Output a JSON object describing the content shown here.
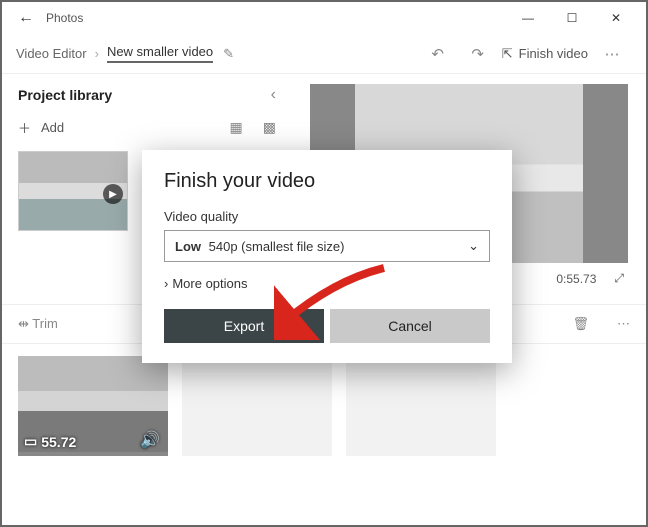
{
  "app": {
    "title": "Photos"
  },
  "breadcrumb": {
    "root": "Video Editor",
    "current": "New smaller video"
  },
  "toolbar": {
    "finish_label": "Finish video"
  },
  "library": {
    "title": "Project library",
    "add_label": "Add"
  },
  "preview": {
    "time": "0:55.73"
  },
  "strip": {
    "trim_label": "Trim",
    "clip_duration": "55.72"
  },
  "dialog": {
    "title": "Finish your video",
    "quality_label": "Video quality",
    "quality_strong": "Low",
    "quality_rest": "540p (smallest file size)",
    "more_label": "More options",
    "export_label": "Export",
    "cancel_label": "Cancel"
  }
}
